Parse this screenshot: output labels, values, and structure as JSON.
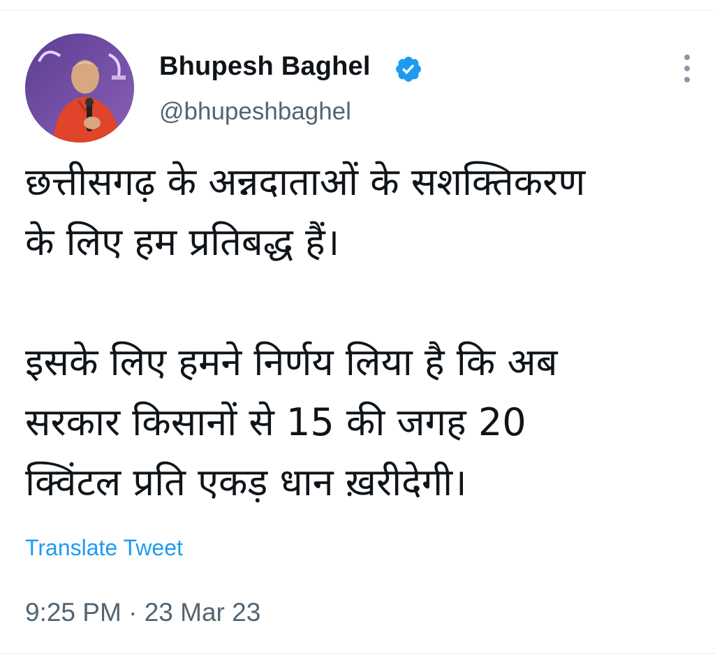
{
  "tweet": {
    "author": {
      "display_name": "Bhupesh Baghel",
      "handle": "@bhupeshbaghel",
      "verified": true,
      "avatar_icon": "profile-photo"
    },
    "text_lines": [
      "छत्तीसगढ़ के अन्नदाताओं के सशक्तिकरण",
      "के लिए हम प्रतिबद्ध हैं।",
      "",
      "इसके लिए हमने निर्णय लिया है कि अब",
      "सरकार किसानों से 15 की जगह 20",
      "क्विंटल प्रति एकड़ धान ख़रीदेगी।"
    ],
    "translate_label": "Translate Tweet",
    "time": "9:25 PM",
    "separator": "·",
    "date": "23 Mar 23"
  },
  "colors": {
    "accent": "#1d9bf0",
    "text_primary": "#0f1419",
    "text_secondary": "#536471"
  },
  "icons": {
    "verified": "verified-badge-icon",
    "more": "more-options-icon"
  }
}
